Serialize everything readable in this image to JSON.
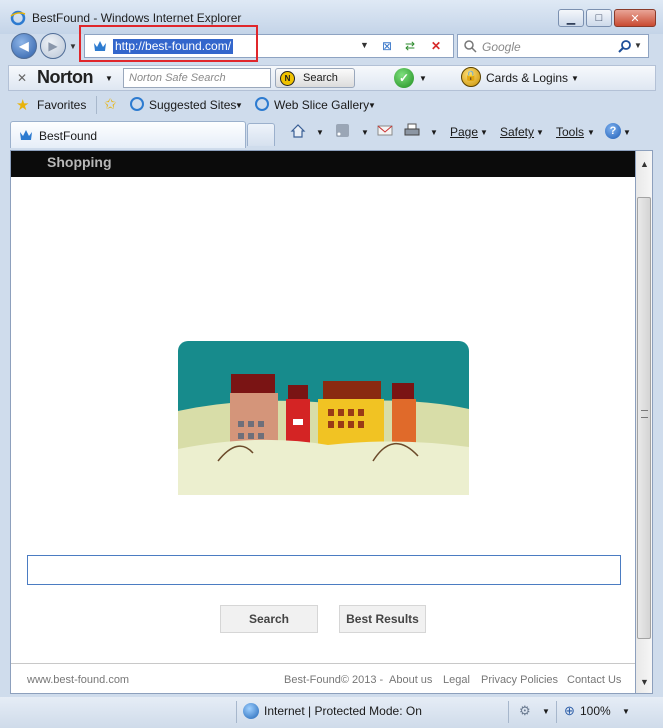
{
  "window": {
    "title": "BestFound - Windows Internet Explorer"
  },
  "address": {
    "url": "http://best-found.com/"
  },
  "search": {
    "placeholder": "Google"
  },
  "norton": {
    "logo": "Norton",
    "search_placeholder": "Norton Safe Search",
    "search_button": "Search",
    "cards_label": "Cards & Logins"
  },
  "favorites": {
    "label": "Favorites",
    "items": [
      "Suggested Sites",
      "Web Slice Gallery"
    ]
  },
  "tab": {
    "title": "BestFound"
  },
  "commandbar": {
    "page": "Page",
    "safety": "Safety",
    "tools": "Tools"
  },
  "page": {
    "nav_label": "Shopping",
    "search_button": "Search",
    "best_results_button": "Best Results",
    "footer": {
      "site": "www.best-found.com",
      "copyright": "Best-Found© 2013 -",
      "links": [
        "About us",
        "Legal",
        "Privacy Policies",
        "Contact Us"
      ]
    }
  },
  "statusbar": {
    "zone": "Internet | Protected Mode: On",
    "zoom": "100%"
  },
  "colors": {
    "highlight": "#e0262b",
    "nav_bar": "#0b0b0b",
    "input_border": "#4b7cc2"
  }
}
